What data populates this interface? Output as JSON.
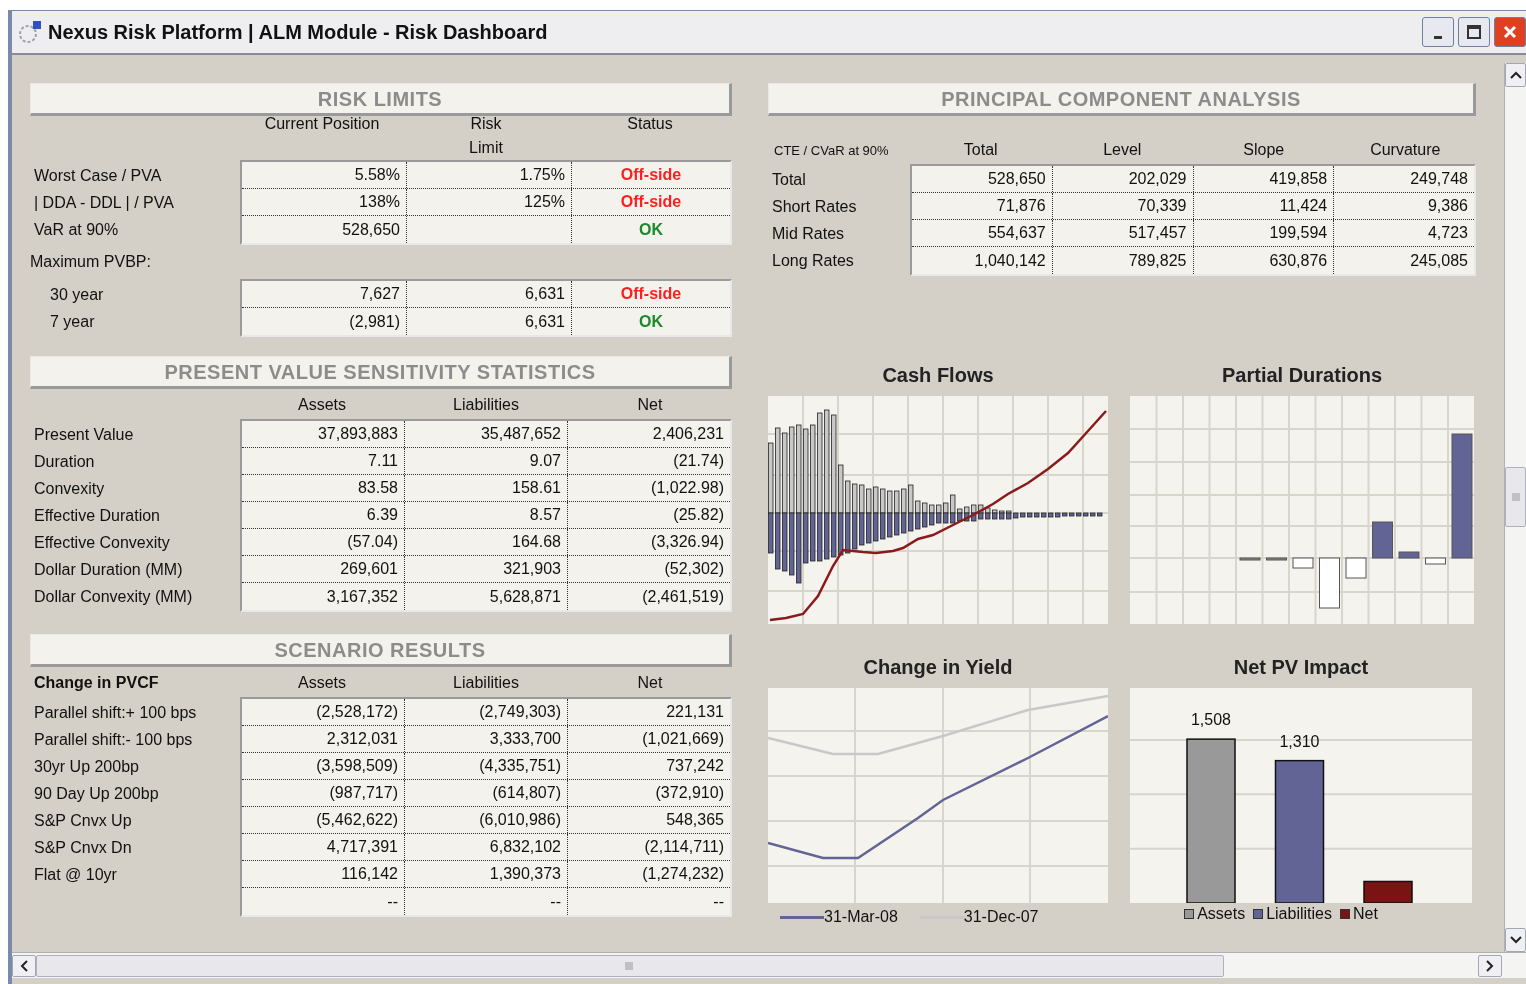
{
  "window": {
    "title": "Nexus Risk Platform | ALM Module - Risk Dashboard"
  },
  "risk_limits": {
    "title": "RISK LIMITS",
    "columns": [
      "Current Position",
      "Risk Limit",
      "Status"
    ],
    "groups": [
      {
        "rows": [
          {
            "label": "Worst Case / PVA",
            "current": "5.58%",
            "limit": "1.75%",
            "status": {
              "text": "Off-side",
              "kind": "breach"
            }
          },
          {
            "label": "| DDA - DDL | / PVA",
            "current": "138%",
            "limit": "125%",
            "status": {
              "text": "Off-side",
              "kind": "breach"
            }
          },
          {
            "label": "VaR at 90%",
            "current": "528,650",
            "status": {
              "text": "OK",
              "kind": "ok"
            }
          }
        ]
      },
      {
        "heading": "Maximum PVBP:",
        "rows": [
          {
            "label": "30 year",
            "current": "7,627",
            "limit": "6,631",
            "status": {
              "text": "Off-side",
              "kind": "breach"
            }
          },
          {
            "label": "7 year",
            "current": "(2,981)",
            "limit": "6,631",
            "status": {
              "text": "OK",
              "kind": "ok"
            }
          }
        ]
      }
    ]
  },
  "pv_sensitivity": {
    "title": "PRESENT VALUE SENSITIVITY STATISTICS",
    "columns": [
      "Assets",
      "Liabilities",
      "Net"
    ],
    "rows": [
      {
        "label": "Present Value",
        "cells": [
          "37,893,883",
          "35,487,652",
          "2,406,231"
        ]
      },
      {
        "label": "Duration",
        "cells": [
          "7.11",
          "9.07",
          "(21.74)"
        ]
      },
      {
        "label": "Convexity",
        "cells": [
          "83.58",
          "158.61",
          "(1,022.98)"
        ]
      },
      {
        "label": "Effective Duration",
        "cells": [
          "6.39",
          "8.57",
          "(25.82)"
        ]
      },
      {
        "label": "Effective Convexity",
        "cells": [
          "(57.04)",
          "164.68",
          "(3,326.94)"
        ]
      },
      {
        "label": "Dollar Duration (MM)",
        "cells": [
          "269,601",
          "321,903",
          "(52,302)"
        ]
      },
      {
        "label": "Dollar Convexity (MM)",
        "cells": [
          "3,167,352",
          "5,628,871",
          "(2,461,519)"
        ]
      }
    ]
  },
  "scenario_results": {
    "title": "SCENARIO RESULTS",
    "corner": "Change in PVCF",
    "columns": [
      "Assets",
      "Liabilities",
      "Net"
    ],
    "rows": [
      {
        "label": "Parallel shift:+ 100 bps",
        "cells": [
          "(2,528,172)",
          "(2,749,303)",
          "221,131"
        ]
      },
      {
        "label": "Parallel shift:- 100 bps",
        "cells": [
          "2,312,031",
          "3,333,700",
          "(1,021,669)"
        ]
      },
      {
        "label": "30yr Up 200bp",
        "cells": [
          "(3,598,509)",
          "(4,335,751)",
          "737,242"
        ]
      },
      {
        "label": "90 Day Up 200bp",
        "cells": [
          "(987,717)",
          "(614,807)",
          "(372,910)"
        ]
      },
      {
        "label": "S&P Cnvx Up",
        "cells": [
          "(5,462,622)",
          "(6,010,986)",
          "548,365"
        ]
      },
      {
        "label": "S&P Cnvx Dn",
        "cells": [
          "4,717,391",
          "6,832,102",
          "(2,114,711)"
        ]
      },
      {
        "label": "Flat @ 10yr",
        "cells": [
          "116,142",
          "1,390,373",
          "(1,274,232)"
        ]
      },
      {
        "cells": [
          "--",
          "--",
          "--"
        ]
      }
    ]
  },
  "pca": {
    "title": "PRINCIPAL COMPONENT ANALYSIS",
    "corner": "CTE / CVaR at 90%",
    "columns": [
      "Total",
      "Level",
      "Slope",
      "Curvature"
    ],
    "rows": [
      {
        "label": "Total",
        "cells": [
          "528,650",
          "202,029",
          "419,858",
          "249,748"
        ]
      },
      {
        "label": "Short Rates",
        "cells": [
          "71,876",
          "70,339",
          "11,424",
          "9,386"
        ]
      },
      {
        "label": "Mid Rates",
        "cells": [
          "554,637",
          "517,457",
          "199,594",
          "4,723"
        ]
      },
      {
        "label": "Long Rates",
        "cells": [
          "1,040,142",
          "789,825",
          "630,876",
          "245,085"
        ]
      }
    ]
  },
  "cash_flows": {
    "title": "Cash Flows"
  },
  "partial_durations": {
    "title": "Partial Durations"
  },
  "change_in_yield": {
    "title": "Change in Yield",
    "legend": [
      {
        "label": "31-Mar-08",
        "color": "#626496"
      },
      {
        "label": "31-Dec-07",
        "color": "#c8c8c8"
      }
    ]
  },
  "net_pv_impact": {
    "title": "Net PV Impact",
    "legend": [
      {
        "label": "Assets",
        "color": "#999999",
        "bar_label": "1,508"
      },
      {
        "label": "Liabilities",
        "color": "#626496",
        "bar_label": "1,310"
      },
      {
        "label": "Net",
        "color": "#7a1414"
      }
    ]
  }
}
